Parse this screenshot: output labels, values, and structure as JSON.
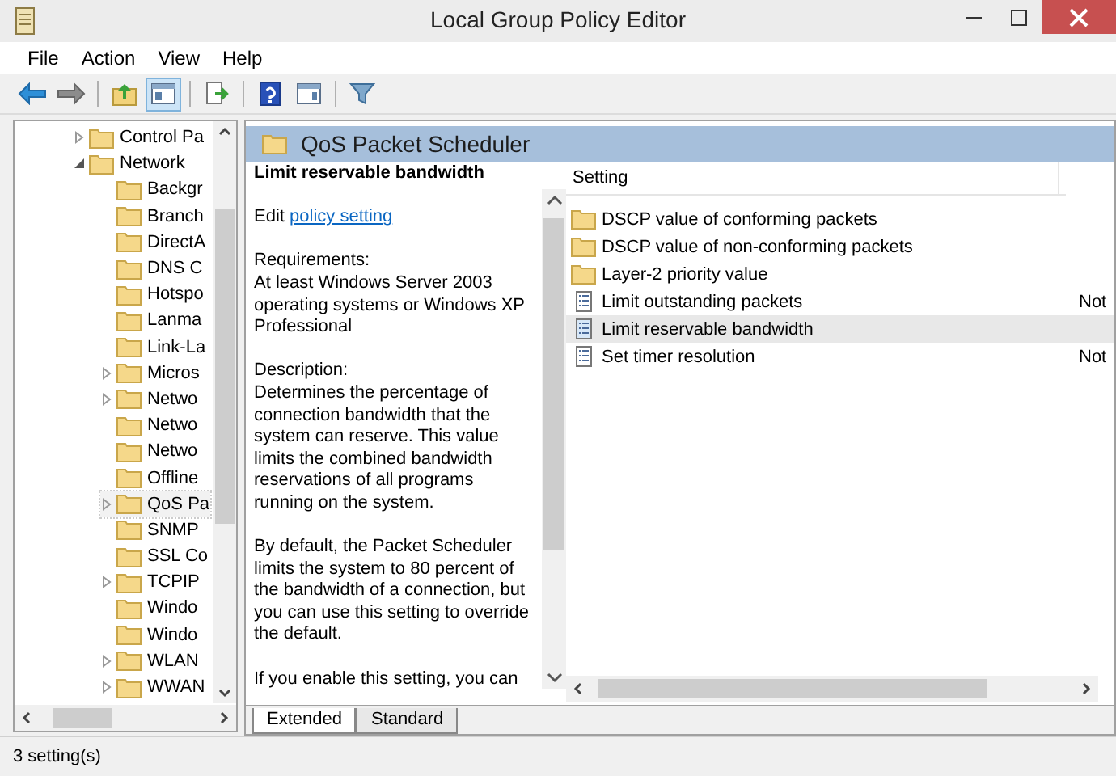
{
  "window": {
    "title": "Local Group Policy Editor"
  },
  "menu": [
    "File",
    "Action",
    "View",
    "Help"
  ],
  "toolbar": [
    {
      "kind": "back",
      "pressed": false
    },
    {
      "kind": "forward",
      "pressed": false
    },
    {
      "kind": "sep"
    },
    {
      "kind": "up",
      "pressed": false
    },
    {
      "kind": "tree",
      "pressed": true
    },
    {
      "kind": "sep"
    },
    {
      "kind": "export",
      "pressed": false
    },
    {
      "kind": "sep"
    },
    {
      "kind": "help",
      "pressed": false
    },
    {
      "kind": "pane",
      "pressed": false
    },
    {
      "kind": "sep"
    },
    {
      "kind": "filter",
      "pressed": false
    }
  ],
  "tree": [
    {
      "label": "Control Pa",
      "expanded": false,
      "selected": false
    },
    {
      "label": "Network",
      "expanded": true,
      "selected": false,
      "children": [
        {
          "label": "Backgr",
          "selected": false
        },
        {
          "label": "Branch",
          "selected": false
        },
        {
          "label": "DirectA",
          "selected": false
        },
        {
          "label": "DNS C",
          "selected": false
        },
        {
          "label": "Hotspo",
          "selected": false
        },
        {
          "label": "Lanma",
          "selected": false
        },
        {
          "label": "Link-La",
          "selected": false
        },
        {
          "label": "Micros",
          "expanded": false,
          "selected": false
        },
        {
          "label": "Netwo",
          "expanded": false,
          "selected": false
        },
        {
          "label": "Netwo",
          "selected": false
        },
        {
          "label": "Netwo",
          "selected": false
        },
        {
          "label": "Offline",
          "selected": false
        },
        {
          "label": "QoS Pa",
          "expanded": false,
          "selected": true
        },
        {
          "label": "SNMP",
          "selected": false
        },
        {
          "label": "SSL Co",
          "selected": false
        },
        {
          "label": "TCPIP",
          "expanded": false,
          "selected": false
        },
        {
          "label": "Windo",
          "selected": false
        },
        {
          "label": "Windo",
          "selected": false
        },
        {
          "label": "WLAN",
          "expanded": false,
          "selected": false
        },
        {
          "label": "WWAN",
          "expanded": false,
          "selected": false
        }
      ]
    }
  ],
  "details": {
    "header": "QoS Packet Scheduler",
    "title": "Limit reservable bandwidth",
    "edit_prefix": "Edit",
    "edit_link": "policy setting",
    "requirements_label": "Requirements:",
    "requirements": "At least Windows Server 2003 operating systems or Windows XP Professional",
    "description_label": "Description:",
    "paragraphs": [
      "Determines the percentage of connection bandwidth that the system can reserve. This value limits the combined bandwidth reservations of all programs running on the system.",
      "By default, the Packet Scheduler limits the system to 80 percent of the bandwidth of a connection, but you can use this setting to override the default.",
      "If you enable this setting, you can"
    ]
  },
  "list": {
    "columns": [
      "Setting"
    ],
    "rows": [
      {
        "kind": "folder",
        "name": "DSCP value of conforming packets",
        "selected": false
      },
      {
        "kind": "folder",
        "name": "DSCP value of non-conforming packets",
        "selected": false
      },
      {
        "kind": "folder",
        "name": "Layer-2 priority value",
        "selected": false
      },
      {
        "kind": "setting",
        "name": "Limit outstanding packets",
        "column_2": "Not",
        "selected": false
      },
      {
        "kind": "setting",
        "name": "Limit reservable bandwidth",
        "selected": true
      },
      {
        "kind": "setting",
        "name": "Set timer resolution",
        "column_2": "Not",
        "selected": false
      }
    ]
  },
  "tabs": [
    {
      "label": "Extended",
      "selected": true
    },
    {
      "label": "Standard",
      "selected": false
    }
  ],
  "status_bar": "3 setting(s)"
}
